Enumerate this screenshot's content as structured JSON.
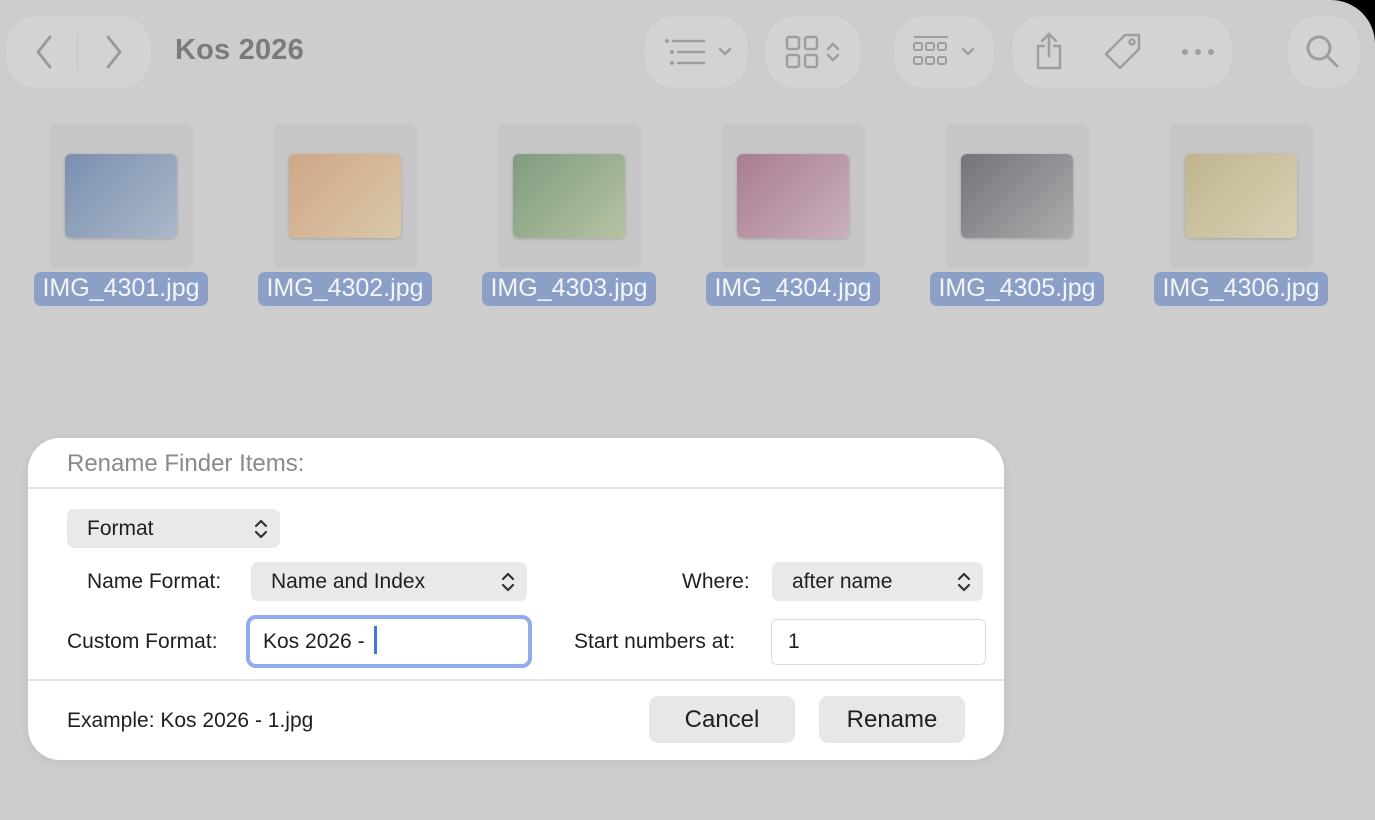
{
  "window": {
    "title": "Kos 2026"
  },
  "toolbar": {
    "back_icon": "chevron-left-icon",
    "forward_icon": "chevron-right-icon",
    "list_view_icon": "list-icon",
    "icon_view_icon": "grid-icon",
    "group_icon": "group-grid-icon",
    "share_icon": "share-icon",
    "tag_icon": "tag-icon",
    "more_icon": "ellipsis-icon",
    "search_icon": "search-icon"
  },
  "files": [
    {
      "name": "IMG_4301.jpg",
      "color_a": "#7c8fb0",
      "color_b": "#aab8c8"
    },
    {
      "name": "IMG_4302.jpg",
      "color_a": "#cfa788",
      "color_b": "#d9c8a7"
    },
    {
      "name": "IMG_4303.jpg",
      "color_a": "#7f9b80",
      "color_b": "#b6c3a2"
    },
    {
      "name": "IMG_4304.jpg",
      "color_a": "#a87d92",
      "color_b": "#cab0bd"
    },
    {
      "name": "IMG_4305.jpg",
      "color_a": "#727478",
      "color_b": "#acacae"
    },
    {
      "name": "IMG_4306.jpg",
      "color_a": "#c1b58f",
      "color_b": "#d6d0b4"
    }
  ],
  "dialog": {
    "title": "Rename Finder Items:",
    "mode_value": "Format",
    "name_format_label": "Name Format:",
    "name_format_value": "Name and Index",
    "where_label": "Where:",
    "where_value": "after name",
    "custom_format_label": "Custom Format:",
    "custom_format_value": "Kos 2026 - ",
    "start_label": "Start numbers at:",
    "start_value": "1",
    "example": "Example: Kos 2026 - 1.jpg",
    "cancel_label": "Cancel",
    "rename_label": "Rename"
  },
  "colors": {
    "selection": "#8c9fc6",
    "focus_ring": "#90abee",
    "caret": "#3f74e6"
  }
}
